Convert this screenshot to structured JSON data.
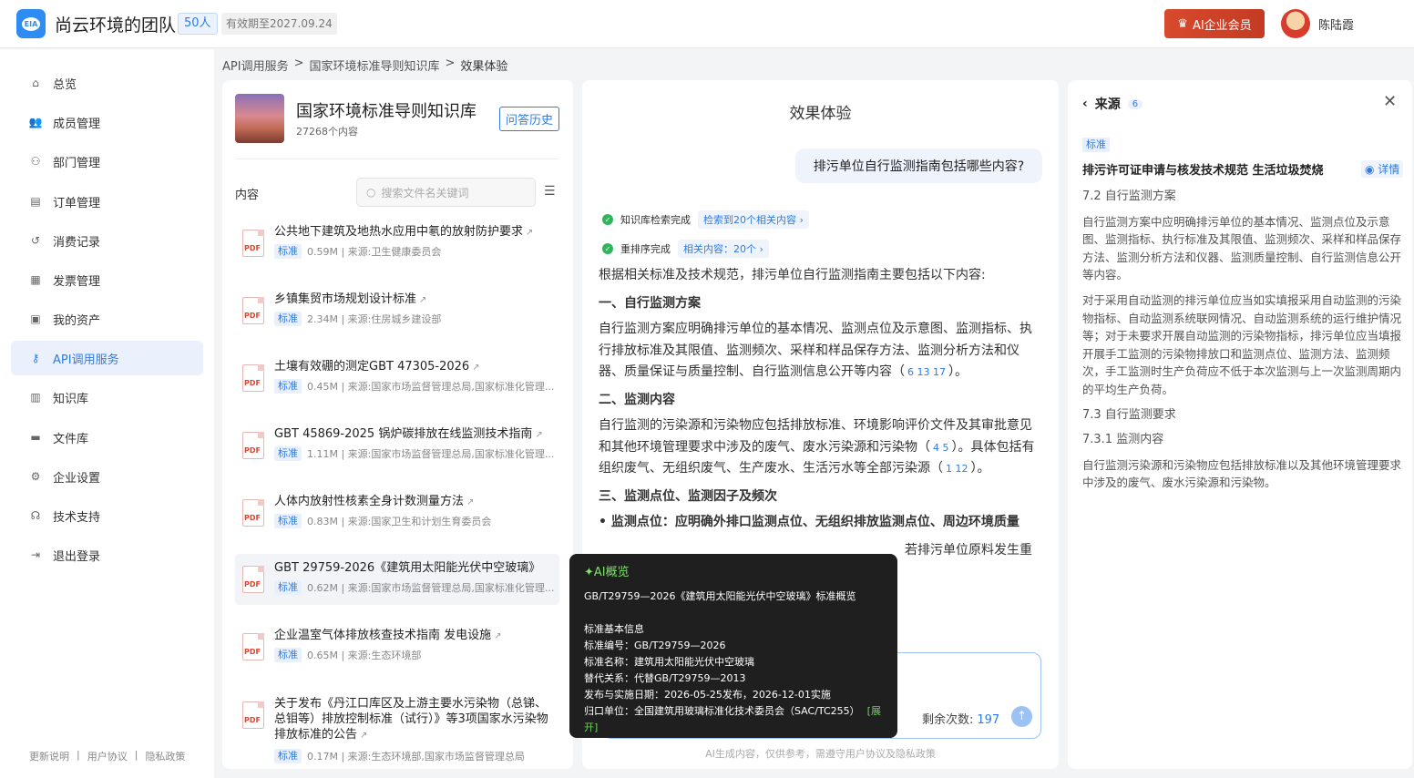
{
  "header": {
    "logo_text": "EIA",
    "team_name": "尚云环境的团队",
    "member_count": "50人",
    "expire": "有效期至2027.09.24",
    "vip_label": "AI企业会员",
    "user_name": "陈陆霞"
  },
  "sidebar": {
    "items": [
      {
        "label": "总览",
        "icon": "home-icon"
      },
      {
        "label": "成员管理",
        "icon": "users-icon"
      },
      {
        "label": "部门管理",
        "icon": "org-icon"
      },
      {
        "label": "订单管理",
        "icon": "order-icon"
      },
      {
        "label": "消费记录",
        "icon": "history-icon"
      },
      {
        "label": "发票管理",
        "icon": "invoice-icon"
      },
      {
        "label": "我的资产",
        "icon": "wallet-icon"
      },
      {
        "label": "API调用服务",
        "icon": "key-icon"
      },
      {
        "label": "知识库",
        "icon": "book-icon"
      },
      {
        "label": "文件库",
        "icon": "folder-icon"
      },
      {
        "label": "企业设置",
        "icon": "gear-icon"
      },
      {
        "label": "技术支持",
        "icon": "headset-icon"
      },
      {
        "label": "退出登录",
        "icon": "logout-icon"
      }
    ],
    "active_index": 7,
    "footer": [
      "更新说明",
      "|",
      "用户协议",
      "|",
      "隐私政策"
    ]
  },
  "breadcrumb": [
    "API调用服务",
    ">",
    "国家环境标准导则知识库",
    ">",
    "效果体验"
  ],
  "kb": {
    "title": "国家环境标准导则知识库",
    "count": "27268个内容",
    "history_btn": "问答历史",
    "content_label": "内容",
    "search_placeholder": "搜索文件名关键词",
    "files": [
      {
        "title": "公共地下建筑及地热水应用中氡的放射防护要求",
        "tag": "标准",
        "meta": "0.59M  |  来源:卫生健康委员会"
      },
      {
        "title": "乡镇集贸市场规划设计标准",
        "tag": "标准",
        "meta": "2.34M  |  来源:住房城乡建设部"
      },
      {
        "title": "土壤有效硼的测定GBT 47305-2026",
        "tag": "标准",
        "meta": "0.45M  |  来源:国家市场监督管理总局,国家标准化管理..."
      },
      {
        "title": "GBT 45869-2025 锅炉碳排放在线监测技术指南",
        "tag": "标准",
        "meta": "1.11M  |  来源:国家市场监督管理总局,国家标准化管理..."
      },
      {
        "title": "人体内放射性核素全身计数测量方法",
        "tag": "标准",
        "meta": "0.83M  |  来源:国家卫生和计划生育委员会"
      },
      {
        "title": "GBT 29759-2026《建筑用太阳能光伏中空玻璃》",
        "tag": "标准",
        "meta": "0.62M  |  来源:国家市场监督管理总局,国家标准化管理..."
      },
      {
        "title": "企业温室气体排放核查技术指南 发电设施",
        "tag": "标准",
        "meta": "0.65M  |  来源:生态环境部"
      },
      {
        "title": "关于发布《丹江口库区及上游主要水污染物（总锑、总钼等）排放控制标准（试行）》等3项国家水污染物排放标准的公告",
        "tag": "标准",
        "meta": "0.17M  |  来源:生态环境部,国家市场监督管理总局"
      }
    ]
  },
  "chat": {
    "title": "效果体验",
    "question": "排污单位自行监测指南包括哪些内容?",
    "status1_text": "知识库检索完成",
    "status1_link": "检索到20个相关内容 ›",
    "status2_text": "重排序完成",
    "status2_link": "相关内容：20个 ›",
    "intro": "根据相关标准及技术规范，排污单位自行监测指南主要包括以下内容:",
    "h1": "一、自行监测方案",
    "p1": "自行监测方案应明确排污单位的基本情况、监测点位及示意图、监测指标、执行排放标准及其限值、监测频次、采样和样品保存方法、监测分析方法和仪器、质量保证与质量控制、自行监测信息公开等内容（",
    "p1_refs": "6   13   17",
    "p1_end": "）。",
    "h2": "二、监测内容",
    "p2": "自行监测的污染源和污染物应包括排放标准、环境影响评价文件及其审批意见和其他环境管理要求中涉及的废气、废水污染源和污染物（",
    "p2_refs": "4   5",
    "p2_mid": "）。具体包括有组织废气、无组织废气、生产废水、生活污水等全部污染源（",
    "p2_refs2": "1   12",
    "p2_end": "）。",
    "h3": "三、监测点位、监测因子及频次",
    "p3": "• 监测点位：应明确外排口监测点位、无组织排放监测点位、周边环境质量",
    "p3b": "若排污单位原料发生重",
    "remain_label": "剩余次数:",
    "remain_value": "197",
    "disclaimer": "AI生成内容，仅供参考，需遵守用户协议及隐私政策"
  },
  "source": {
    "title": "来源",
    "count": "6",
    "tag": "标准",
    "doc_title": "排污许可证申请与核发技术规范 生活垃圾焚烧",
    "detail": "详情",
    "sec1": "7.2 自行监测方案",
    "p1": "自行监测方案中应明确排污单位的基本情况、监测点位及示意图、监测指标、执行标准及其限值、监测频次、采样和样品保存方法、监测分析方法和仪器、监测质量控制、自行监测信息公开等内容。",
    "p2": "对于采用自动监测的排污单位应当如实填报采用自动监测的污染物指标、自动监测系统联网情况、自动监测系统的运行维护情况等；对于未要求开展自动监测的污染物指标，排污单位应当填报开展手工监测的污染物排放口和监测点位、监测方法、监测频次，手工监测时生产负荷应不低于本次监测与上一次监测周期内的平均生产负荷。",
    "sec2": "7.3 自行监测要求",
    "sec3": "7.3.1 监测内容",
    "p3": "自行监测污染源和污染物应包括排放标准以及其他环境管理要求中涉及的废气、废水污染源和污染物。"
  },
  "popup": {
    "head": "AI概览",
    "line1": "GB/T29759—2026《建筑用太阳能光伏中空玻璃》标准概览",
    "line2": "标准基本信息",
    "line3": "标准编号：GB/T29759—2026",
    "line4": "标准名称：建筑用太阳能光伏中空玻璃",
    "line5": "替代关系：代替GB/T29759—2013",
    "line6": "发布与实施日期：2026-05-25发布，2026-12-01实施",
    "line7": "归口单位：全国建筑用玻璃标准化技术委员会（SAC/TC255）",
    "expand": "[展开]"
  }
}
